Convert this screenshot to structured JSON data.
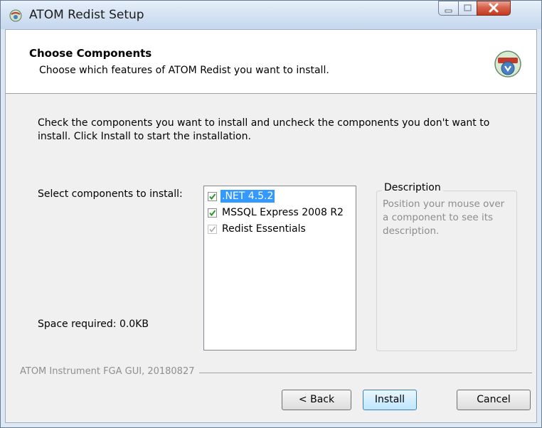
{
  "window": {
    "title": "ATOM Redist Setup"
  },
  "header": {
    "title": "Choose Components",
    "subtitle": "Choose which features of ATOM Redist you want to install.",
    "icon": "installer-globe-icon"
  },
  "body": {
    "instructions": "Check the components you want to install and uncheck the components you don't want to install. Click Install to start the installation.",
    "select_label": "Select components to install:",
    "space_required": "Space required: 0.0KB"
  },
  "components": [
    {
      "label": ".NET 4.5.2",
      "checked": true,
      "selected": true,
      "disabled": false
    },
    {
      "label": "MSSQL Express 2008 R2",
      "checked": true,
      "selected": false,
      "disabled": false
    },
    {
      "label": "Redist Essentials",
      "checked": true,
      "selected": false,
      "disabled": true
    }
  ],
  "description": {
    "title": "Description",
    "text": "Position your mouse over a component to see its description."
  },
  "branding": "ATOM Instrument FGA GUI, 20180827",
  "buttons": {
    "back": "< Back",
    "install": "Install",
    "cancel": "Cancel"
  },
  "colors": {
    "selection": "#3399ff",
    "checkmark": "#2a9a2a",
    "disabled_check": "#a8a8a8"
  }
}
